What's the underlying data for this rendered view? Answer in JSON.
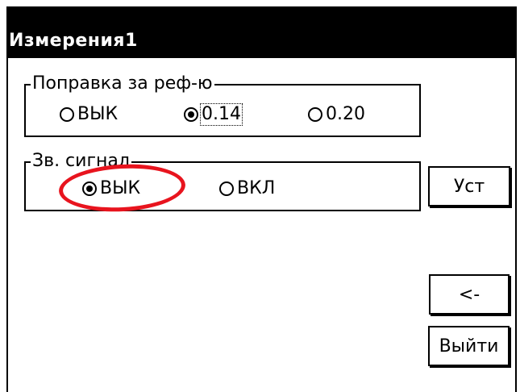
{
  "window": {
    "title": "Измерения1"
  },
  "refraction_group": {
    "legend": "Поправка за реф-ю",
    "options": [
      {
        "label": "ВЫК",
        "checked": false
      },
      {
        "label": "0.14",
        "checked": true,
        "focused": true
      },
      {
        "label": "0.20",
        "checked": false
      }
    ]
  },
  "sound_group": {
    "legend": "Зв. сигнал",
    "options": [
      {
        "label": "ВЫК",
        "checked": true
      },
      {
        "label": "ВКЛ",
        "checked": false
      }
    ]
  },
  "buttons": {
    "set": "Уст",
    "back": "<-",
    "exit": "Выйти"
  },
  "colors": {
    "titlebar": "#000000",
    "annotation": "#e8141e"
  }
}
